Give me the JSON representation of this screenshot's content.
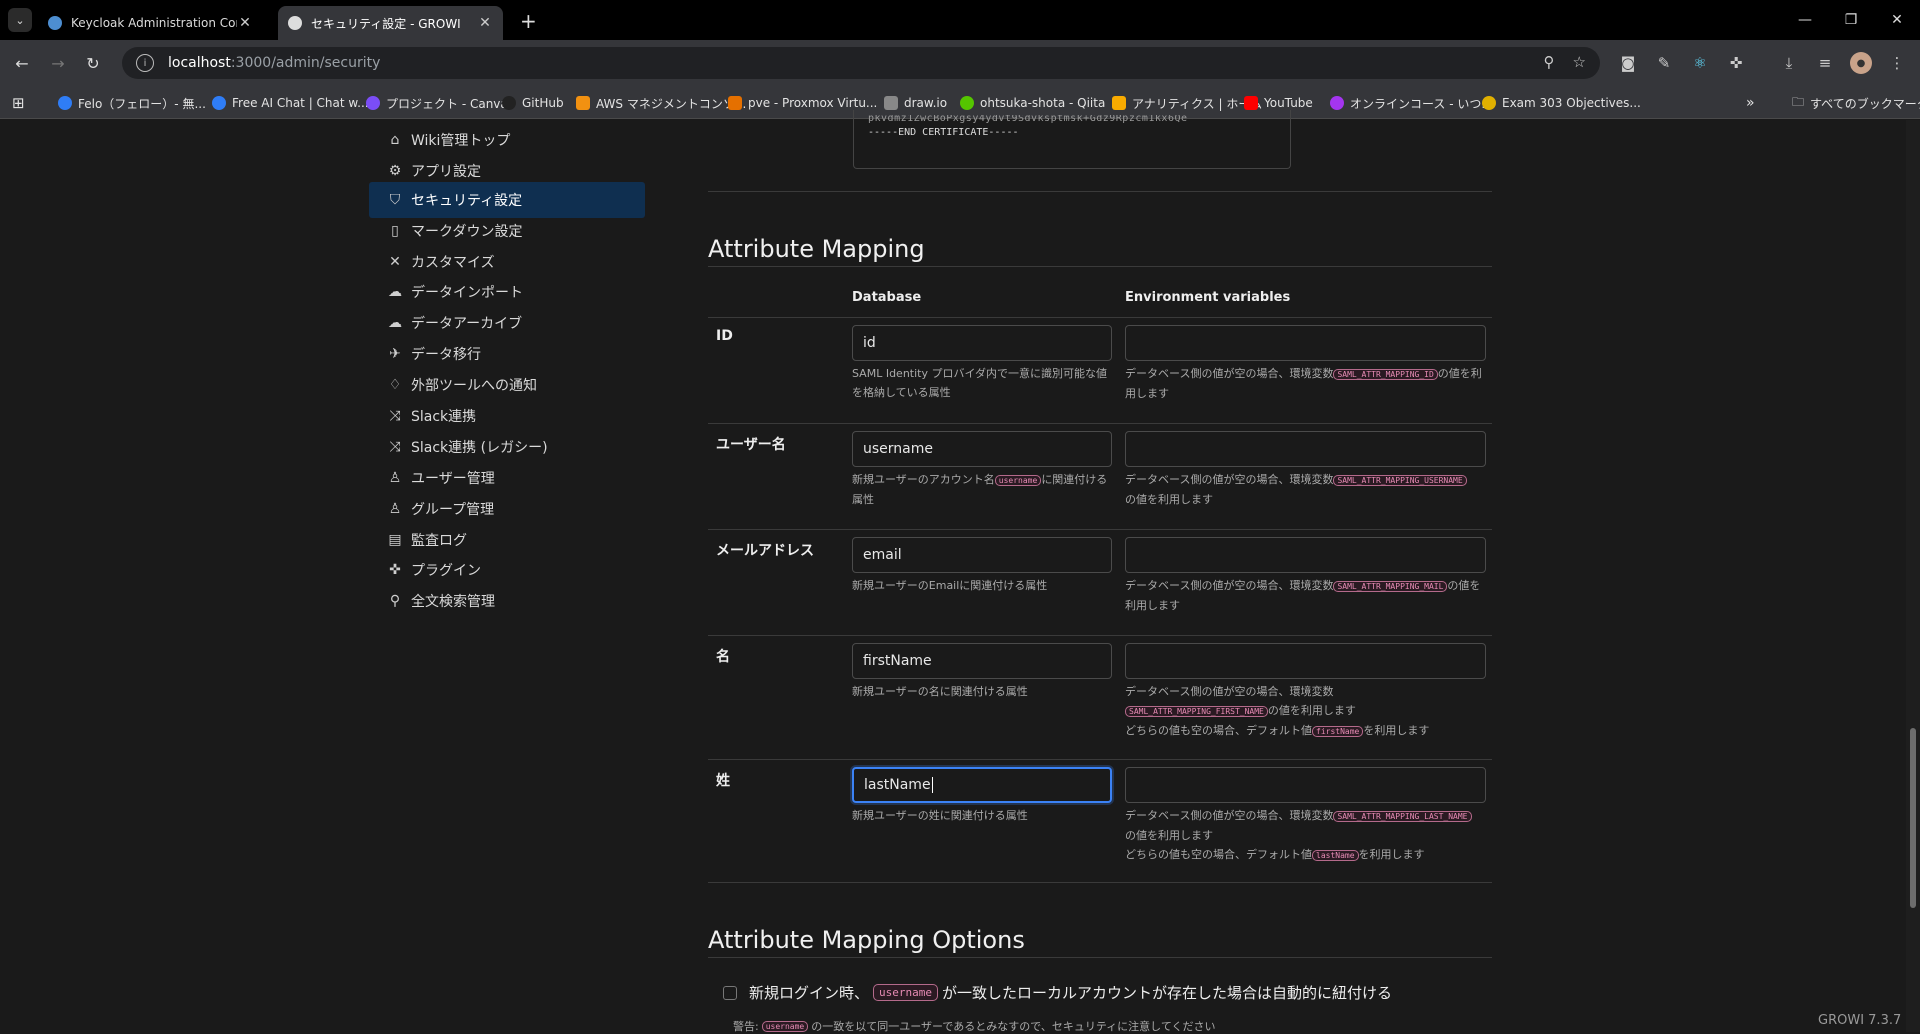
{
  "browser": {
    "tabs": [
      {
        "title": "Keycloak Administration Console",
        "active": false,
        "favicon_color": "#4d8ed1"
      },
      {
        "title": "セキュリティ設定 - GROWI",
        "active": true,
        "favicon_color": "#dddddd"
      }
    ],
    "url_host": "localhost",
    "url_path": ":3000/admin/security",
    "bookmarks": [
      {
        "label": "Felo（フェロー）- 無...",
        "color": "#2f7df6"
      },
      {
        "label": "Free AI Chat | Chat w...",
        "color": "#2f7df6"
      },
      {
        "label": "プロジェクト - Canva",
        "color": "#7b4df6"
      },
      {
        "label": "GitHub",
        "color": "#222222"
      },
      {
        "label": "AWS マネジメントコンソ...",
        "color": "#f29111"
      },
      {
        "label": "pve - Proxmox Virtu...",
        "color": "#e57000"
      },
      {
        "label": "draw.io",
        "color": "#888888"
      },
      {
        "label": "ohtsuka-shota - Qiita",
        "color": "#55c500"
      },
      {
        "label": "アナリティクス | ホーム",
        "color": "#f9ab00"
      },
      {
        "label": "YouTube",
        "color": "#ff0000"
      },
      {
        "label": "オンラインコース - いつ...",
        "color": "#a435f0"
      },
      {
        "label": "Exam 303 Objectives...",
        "color": "#e0b000"
      }
    ],
    "all_bookmarks": "すべてのブックマーク"
  },
  "sidebar": {
    "items": [
      {
        "label": "Wiki管理トップ",
        "icon": "home-icon",
        "glyph": "⌂"
      },
      {
        "label": "アプリ設定",
        "icon": "gear-icon",
        "glyph": "⚙"
      },
      {
        "label": "セキュリティ設定",
        "icon": "shield-icon",
        "glyph": "⛉",
        "active": true
      },
      {
        "label": "マークダウン設定",
        "icon": "document-icon",
        "glyph": "▯"
      },
      {
        "label": "カスタマイズ",
        "icon": "tools-icon",
        "glyph": "✕"
      },
      {
        "label": "データインポート",
        "icon": "cloud-upload-icon",
        "glyph": "☁"
      },
      {
        "label": "データアーカイブ",
        "icon": "cloud-archive-icon",
        "glyph": "☁"
      },
      {
        "label": "データ移行",
        "icon": "plane-icon",
        "glyph": "✈"
      },
      {
        "label": "外部ツールへの通知",
        "icon": "bell-icon",
        "glyph": "♢"
      },
      {
        "label": "Slack連携",
        "icon": "shuffle-icon",
        "glyph": "⤨"
      },
      {
        "label": "Slack連携 (レガシー)",
        "icon": "shuffle-icon",
        "glyph": "⤨"
      },
      {
        "label": "ユーザー管理",
        "icon": "user-icon",
        "glyph": "♙"
      },
      {
        "label": "グループ管理",
        "icon": "users-icon",
        "glyph": "♙"
      },
      {
        "label": "監査ログ",
        "icon": "log-icon",
        "glyph": "▤"
      },
      {
        "label": "プラグイン",
        "icon": "puzzle-icon",
        "glyph": "✜"
      },
      {
        "label": "全文検索管理",
        "icon": "search-icon",
        "glyph": "⚲"
      }
    ]
  },
  "certificate_tail": "-----END CERTIFICATE-----",
  "attribute_mapping": {
    "title": "Attribute Mapping",
    "col_database": "Database",
    "col_env": "Environment variables",
    "rows": {
      "id": {
        "label": "ID",
        "db_value": "id",
        "env_value": "",
        "db_help": "SAML Identity プロバイダ内で一意に識別可能な値を格納している属性",
        "env_help_a": "データベース側の値が空の場合、環境変数",
        "env_code": "SAML_ATTR_MAPPING_ID",
        "env_help_b": "の値を利用します"
      },
      "username": {
        "label": "ユーザー名",
        "db_value": "username",
        "env_value": "",
        "db_help_a": "新規ユーザーのアカウント名",
        "db_code": "username",
        "db_help_b": "に関連付ける属性",
        "env_help_a": "データベース側の値が空の場合、環境変数",
        "env_code": "SAML_ATTR_MAPPING_USERNAME",
        "env_help_b": "の値を利用します"
      },
      "email": {
        "label": "メールアドレス",
        "db_value": "email",
        "env_value": "",
        "db_help": "新規ユーザーのEmailに関連付ける属性",
        "env_help_a": "データベース側の値が空の場合、環境変数",
        "env_code": "SAML_ATTR_MAPPING_MAIL",
        "env_help_b": "の値を利用します"
      },
      "first_name": {
        "label": "名",
        "db_value": "firstName",
        "env_value": "",
        "db_help": "新規ユーザーの名に関連付ける属性",
        "env_help_a": "データベース側の値が空の場合、環境変数",
        "env_code": "SAML_ATTR_MAPPING_FIRST_NAME",
        "env_help_b": "の値を利用します",
        "env_help_c": "どちらの値も空の場合、デフォルト値",
        "default_code": "firstName",
        "env_help_d": "を利用します"
      },
      "last_name": {
        "label": "姓",
        "db_value": "lastName",
        "env_value": "",
        "db_help": "新規ユーザーの姓に関連付ける属性",
        "env_help_a": "データベース側の値が空の場合、環境変数",
        "env_code": "SAML_ATTR_MAPPING_LAST_NAME",
        "env_help_b": "の値を利用します",
        "env_help_c": "どちらの値も空の場合、デフォルト値",
        "default_code": "lastName",
        "env_help_d": "を利用します"
      }
    }
  },
  "options": {
    "title": "Attribute Mapping Options",
    "checkbox_a": "新規ログイン時、",
    "checkbox_code": "username",
    "checkbox_b": "が一致したローカルアカウントが存在した場合は自動的に紐付ける",
    "checked": false,
    "warn_a": "警告:",
    "warn_code": "username",
    "warn_b": "の一致を以て同一ユーザーであるとみなすので、セキュリティに注意してください"
  },
  "version": "GROWI 7.3.7"
}
